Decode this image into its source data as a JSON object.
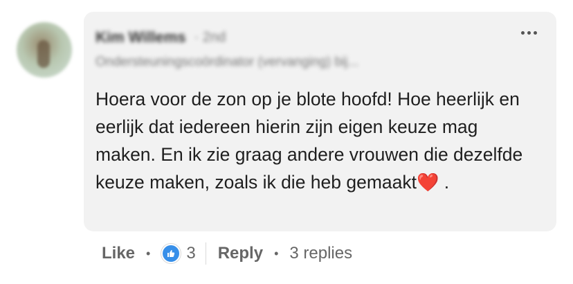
{
  "comment": {
    "author": {
      "name": "Kim Willems",
      "degree": "· 2nd",
      "headline": "Ondersteuningscoördinator (vervanging) bij..."
    },
    "text": "Hoera voor de zon op je blote hoofd! Hoe heerlijk en eerlijk dat iedereen hierin zijn eigen keuze mag maken. En ik zie graag andere vrouwen die dezelfde keuze maken, zoals ik die heb gemaakt",
    "emoji": "❤️",
    "text_end": ".",
    "actions": {
      "like_label": "Like",
      "reaction_count": "3",
      "reply_label": "Reply",
      "replies_label": "3 replies"
    }
  },
  "icons": {
    "more": "more-horizontal-icon",
    "reaction": "thumbs-up-icon"
  },
  "colors": {
    "bubble": "#f2f2f2",
    "reaction_blue": "#378fe9",
    "heart": "#e0242b"
  }
}
